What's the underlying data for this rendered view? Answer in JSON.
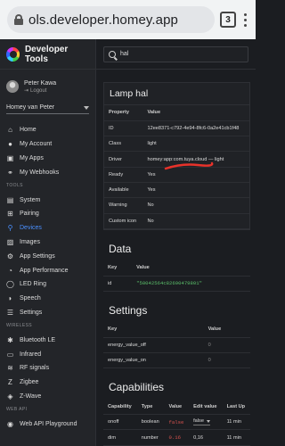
{
  "browser": {
    "url": "ols.developer.homey.app",
    "tab_count": "3"
  },
  "sidebar": {
    "brand": "Developer Tools",
    "user": {
      "name": "Peter Kawa",
      "logout": "Logout"
    },
    "home_select": "Homey van Peter",
    "nav_main": [
      {
        "label": "Home",
        "icon": "home-icon"
      },
      {
        "label": "My Account",
        "icon": "account-icon"
      },
      {
        "label": "My Apps",
        "icon": "apps-icon"
      },
      {
        "label": "My Webhooks",
        "icon": "webhooks-icon"
      }
    ],
    "section_tools": "TOOLS",
    "nav_tools": [
      {
        "label": "System",
        "icon": "system-icon",
        "active": false
      },
      {
        "label": "Pairing",
        "icon": "pairing-icon",
        "active": false
      },
      {
        "label": "Devices",
        "icon": "devices-icon",
        "active": true
      },
      {
        "label": "Images",
        "icon": "images-icon",
        "active": false
      },
      {
        "label": "App Settings",
        "icon": "app-settings-icon",
        "active": false
      },
      {
        "label": "App Performance",
        "icon": "performance-icon",
        "active": false
      },
      {
        "label": "LED Ring",
        "icon": "led-ring-icon",
        "active": false
      },
      {
        "label": "Speech",
        "icon": "speech-icon",
        "active": false
      },
      {
        "label": "Settings",
        "icon": "settings-icon",
        "active": false
      }
    ],
    "section_wireless": "WIRELESS",
    "nav_wireless": [
      {
        "label": "Bluetooth LE",
        "icon": "bluetooth-icon"
      },
      {
        "label": "Infrared",
        "icon": "infrared-icon"
      },
      {
        "label": "RF signals",
        "icon": "rf-icon"
      },
      {
        "label": "Zigbee",
        "icon": "zigbee-icon"
      },
      {
        "label": "Z-Wave",
        "icon": "zwave-icon"
      }
    ],
    "section_webapi": "WEB API",
    "nav_webapi": [
      {
        "label": "Web API Playground",
        "icon": "web-api-icon"
      }
    ]
  },
  "main": {
    "search": {
      "value": "hal"
    },
    "device_card": {
      "title": "Lamp hal",
      "headers": [
        "Property",
        "Value"
      ],
      "rows": [
        [
          "ID",
          "12ee8371-c792-4e94-8fc6-0a2e41cb1f48"
        ],
        [
          "Class",
          "light"
        ],
        [
          "Driver",
          "homey:app:com.tuya.cloud — light"
        ],
        [
          "Ready",
          "Yes"
        ],
        [
          "Available",
          "Yes"
        ],
        [
          "Warning",
          "No"
        ],
        [
          "Custom icon",
          "No"
        ]
      ]
    },
    "data_section": {
      "title": "Data",
      "headers": [
        "Key",
        "Value"
      ],
      "rows": [
        [
          "id",
          "\"50042564c82690479801\""
        ]
      ]
    },
    "settings_section": {
      "title": "Settings",
      "headers": [
        "Key",
        "Value"
      ],
      "rows": [
        [
          "energy_value_off",
          "0"
        ],
        [
          "energy_value_on",
          "0"
        ]
      ]
    },
    "capabilities_section": {
      "title": "Capabilities",
      "headers": [
        "Capability",
        "Type",
        "Value",
        "Edit value",
        "Last Up"
      ],
      "rows": [
        [
          "onoff",
          "boolean",
          "false",
          "false",
          "11 min"
        ],
        [
          "dim",
          "number",
          "0.16",
          "0,16",
          "11 min"
        ]
      ]
    }
  }
}
